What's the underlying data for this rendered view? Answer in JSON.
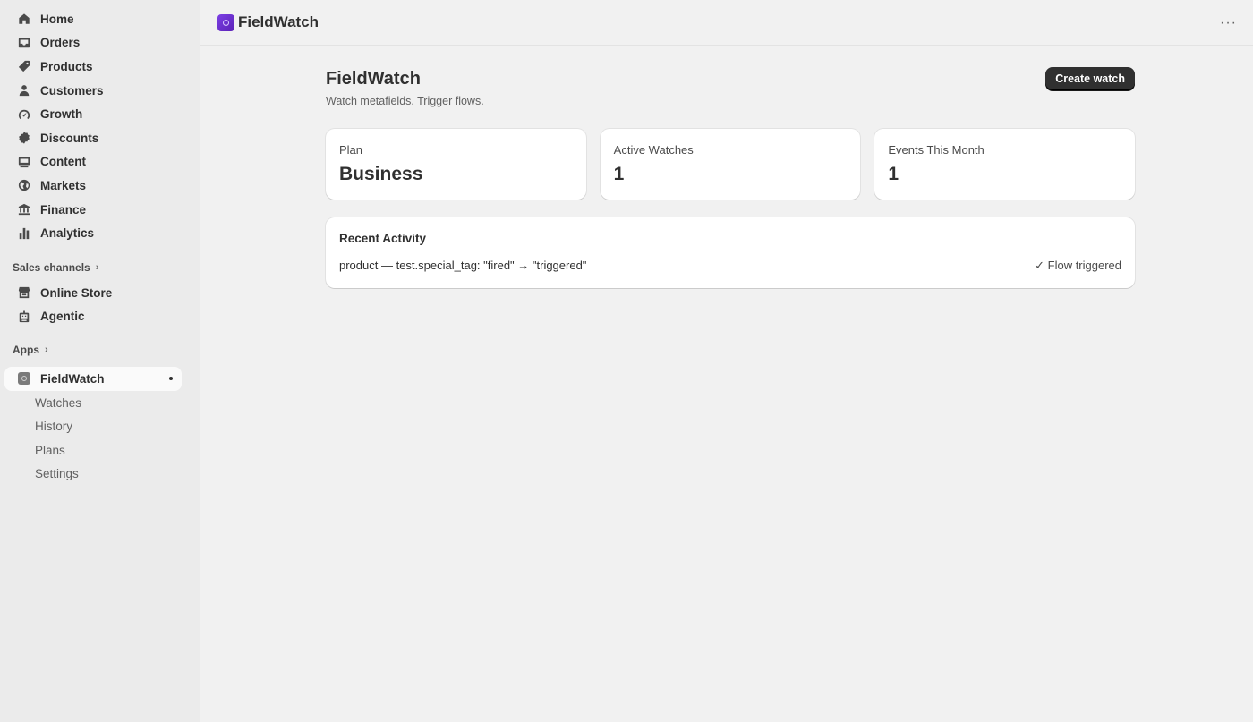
{
  "sidebar": {
    "items": [
      {
        "label": "Home",
        "icon": "home-icon"
      },
      {
        "label": "Orders",
        "icon": "inbox-icon"
      },
      {
        "label": "Products",
        "icon": "tag-icon"
      },
      {
        "label": "Customers",
        "icon": "person-icon"
      },
      {
        "label": "Growth",
        "icon": "gauge-icon"
      },
      {
        "label": "Discounts",
        "icon": "discount-icon"
      },
      {
        "label": "Content",
        "icon": "content-icon"
      },
      {
        "label": "Markets",
        "icon": "globe-icon"
      },
      {
        "label": "Finance",
        "icon": "bank-icon"
      },
      {
        "label": "Analytics",
        "icon": "bar-chart-icon"
      }
    ],
    "sales_channels": {
      "heading": "Sales channels",
      "items": [
        {
          "label": "Online Store",
          "icon": "store-icon"
        },
        {
          "label": "Agentic",
          "icon": "robot-icon"
        }
      ]
    },
    "apps": {
      "heading": "Apps",
      "active_app": "FieldWatch",
      "sub_items": [
        "Watches",
        "History",
        "Plans",
        "Settings"
      ]
    }
  },
  "topbar": {
    "app_name": "FieldWatch",
    "more_label": "···"
  },
  "page": {
    "title": "FieldWatch",
    "subtitle": "Watch metafields. Trigger flows.",
    "primary_action": "Create watch"
  },
  "stats": [
    {
      "label": "Plan",
      "value": "Business"
    },
    {
      "label": "Active Watches",
      "value": "1"
    },
    {
      "label": "Events This Month",
      "value": "1"
    }
  ],
  "activity": {
    "title": "Recent Activity",
    "rows": [
      {
        "text": "product — test.special_tag: \"fired\" → \"triggered\"",
        "status": "✓ Flow triggered"
      }
    ]
  },
  "colors": {
    "brand": "#6d31d9",
    "primary_button": "#303030",
    "sidebar_bg": "#ebebeb",
    "page_bg": "#f1f1f1"
  }
}
